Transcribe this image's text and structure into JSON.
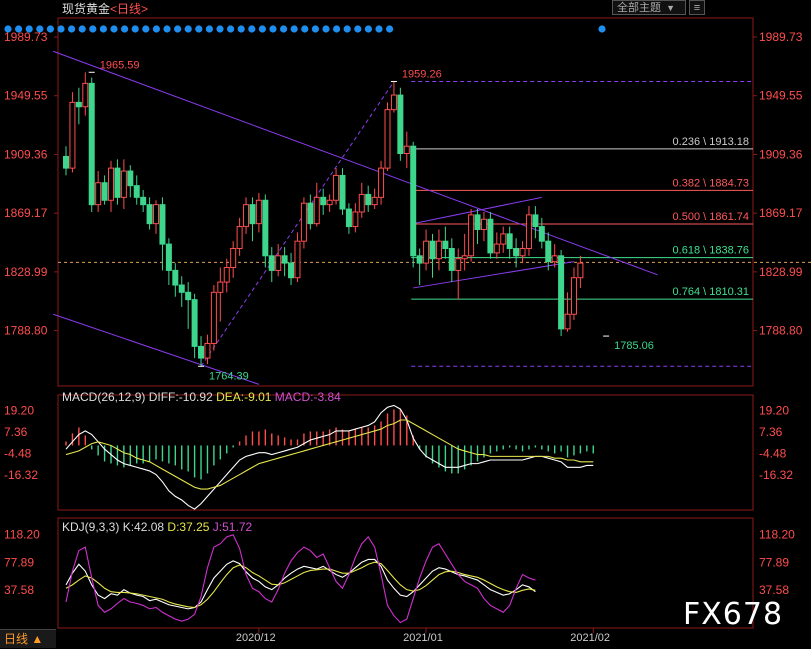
{
  "header": {
    "title": "现货黄金",
    "period_link": "<日线>",
    "theme_button": "全部主题",
    "theme_arrow": "▼"
  },
  "macd_header": {
    "title": "MACD(26,12,9)",
    "diff": "DIFF:-10.92",
    "dea": "DEA:-9.01",
    "macd": "MACD:-3.84"
  },
  "kdj_header": {
    "title": "KDJ(9,3,3)",
    "k": "K:42.08",
    "d": "D:37.25",
    "j": "J:51.72"
  },
  "footer": {
    "period_button": "日线 ▲",
    "watermark": "FX678"
  },
  "colors": {
    "up": "#ff4d4d",
    "down": "#3dd68c",
    "trend": "#8a3cf0",
    "dea": "#e6e64d",
    "macd_label": "#d050d0",
    "label_text": "#ff5050",
    "fib_red": "#ff5a5a",
    "fib_green": "#40e090",
    "fib_grey": "#cccccc"
  },
  "chart_data": {
    "type": "candlestick",
    "instrument": "现货黄金",
    "period": "日线",
    "price_axis_ticks": [
      1989.73,
      1949.55,
      1909.36,
      1869.17,
      1828.99,
      1788.8
    ],
    "price_range": [
      1755,
      2000
    ],
    "x_tick_labels": [
      {
        "label": "2020/12",
        "index": 30
      },
      {
        "label": "2021/01",
        "index": 56
      },
      {
        "label": "2021/02",
        "index": 82
      }
    ],
    "annotations": [
      {
        "text": "1965.59",
        "index": 4,
        "price": 1965.59,
        "color": "up"
      },
      {
        "text": "1764.39",
        "index": 21,
        "price": 1764.39,
        "color": "down"
      },
      {
        "text": "1959.26",
        "index": 51,
        "price": 1959.26,
        "color": "up"
      },
      {
        "text": "1785.06",
        "index": 84,
        "price": 1785.06,
        "color": "down"
      }
    ],
    "fibonacci": [
      {
        "ratio": "0.236",
        "price": 1913.18,
        "label": "0.236 \\ 1913.18",
        "color": "fib_grey"
      },
      {
        "ratio": "0.382",
        "price": 1884.73,
        "label": "0.382 \\ 1884.73",
        "color": "fib_red"
      },
      {
        "ratio": "0.500",
        "price": 1861.74,
        "label": "0.500 \\ 1861.74",
        "color": "fib_red"
      },
      {
        "ratio": "0.618",
        "price": 1838.76,
        "label": "0.618 \\ 1838.76",
        "color": "fib_green"
      },
      {
        "ratio": "0.764",
        "price": 1810.31,
        "label": "0.764 \\ 1810.31",
        "color": "fib_green"
      }
    ],
    "current_price": 1835.5,
    "candles": [
      [
        1908,
        1900,
        1915,
        1895
      ],
      [
        1900,
        1945,
        1952,
        1897
      ],
      [
        1945,
        1942,
        1955,
        1930
      ],
      [
        1942,
        1958,
        1965.59,
        1936
      ],
      [
        1958,
        1875,
        1962,
        1870
      ],
      [
        1875,
        1890,
        1898,
        1870
      ],
      [
        1890,
        1878,
        1895,
        1875
      ],
      [
        1878,
        1900,
        1905,
        1870
      ],
      [
        1900,
        1880,
        1906,
        1875
      ],
      [
        1880,
        1898,
        1906,
        1872
      ],
      [
        1898,
        1888,
        1902,
        1880
      ],
      [
        1888,
        1880,
        1895,
        1875
      ],
      [
        1880,
        1875,
        1885,
        1870
      ],
      [
        1875,
        1862,
        1880,
        1858
      ],
      [
        1862,
        1875,
        1878,
        1855
      ],
      [
        1875,
        1848,
        1880,
        1830
      ],
      [
        1848,
        1830,
        1852,
        1820
      ],
      [
        1830,
        1820,
        1835,
        1812
      ],
      [
        1820,
        1815,
        1826,
        1805
      ],
      [
        1815,
        1810,
        1822,
        1790
      ],
      [
        1810,
        1778,
        1814,
        1770
      ],
      [
        1778,
        1770,
        1785,
        1764.39
      ],
      [
        1770,
        1780,
        1786,
        1766
      ],
      [
        1780,
        1815,
        1820,
        1775
      ],
      [
        1815,
        1822,
        1832,
        1795
      ],
      [
        1822,
        1832,
        1838,
        1815
      ],
      [
        1832,
        1845,
        1850,
        1825
      ],
      [
        1845,
        1860,
        1866,
        1840
      ],
      [
        1860,
        1875,
        1880,
        1855
      ],
      [
        1875,
        1862,
        1880,
        1850
      ],
      [
        1862,
        1878,
        1883,
        1856
      ],
      [
        1878,
        1840,
        1882,
        1832
      ],
      [
        1840,
        1830,
        1846,
        1822
      ],
      [
        1830,
        1840,
        1848,
        1826
      ],
      [
        1840,
        1835,
        1846,
        1826
      ],
      [
        1835,
        1825,
        1842,
        1820
      ],
      [
        1825,
        1850,
        1856,
        1822
      ],
      [
        1850,
        1876,
        1880,
        1845
      ],
      [
        1876,
        1862,
        1882,
        1858
      ],
      [
        1862,
        1880,
        1890,
        1860
      ],
      [
        1880,
        1875,
        1886,
        1868
      ],
      [
        1875,
        1878,
        1882,
        1870
      ],
      [
        1878,
        1895,
        1900,
        1875
      ],
      [
        1895,
        1872,
        1900,
        1868
      ],
      [
        1872,
        1860,
        1876,
        1855
      ],
      [
        1860,
        1870,
        1876,
        1856
      ],
      [
        1870,
        1882,
        1890,
        1866
      ],
      [
        1882,
        1875,
        1888,
        1870
      ],
      [
        1875,
        1880,
        1886,
        1872
      ],
      [
        1880,
        1900,
        1905,
        1875
      ],
      [
        1900,
        1940,
        1945,
        1898
      ],
      [
        1940,
        1950,
        1959.26,
        1938
      ],
      [
        1950,
        1910,
        1955,
        1905
      ],
      [
        1910,
        1915,
        1925,
        1900
      ],
      [
        1915,
        1840,
        1918,
        1832
      ],
      [
        1840,
        1835,
        1845,
        1820
      ],
      [
        1835,
        1850,
        1858,
        1830
      ],
      [
        1850,
        1838,
        1855,
        1825
      ],
      [
        1838,
        1850,
        1858,
        1830
      ],
      [
        1850,
        1845,
        1860,
        1838
      ],
      [
        1845,
        1830,
        1852,
        1822
      ],
      [
        1830,
        1838,
        1845,
        1810
      ],
      [
        1838,
        1840,
        1855,
        1830
      ],
      [
        1840,
        1868,
        1872,
        1836
      ],
      [
        1868,
        1858,
        1872,
        1848
      ],
      [
        1858,
        1865,
        1870,
        1850
      ],
      [
        1865,
        1842,
        1870,
        1838
      ],
      [
        1842,
        1848,
        1856,
        1838
      ],
      [
        1848,
        1855,
        1860,
        1842
      ],
      [
        1855,
        1845,
        1860,
        1838
      ],
      [
        1845,
        1840,
        1852,
        1832
      ],
      [
        1840,
        1845,
        1850,
        1835
      ],
      [
        1845,
        1868,
        1874,
        1840
      ],
      [
        1868,
        1860,
        1874,
        1852
      ],
      [
        1860,
        1850,
        1866,
        1845
      ],
      [
        1850,
        1836,
        1856,
        1830
      ],
      [
        1836,
        1840,
        1848,
        1832
      ],
      [
        1840,
        1790,
        1844,
        1785.06
      ],
      [
        1790,
        1800,
        1815,
        1788
      ],
      [
        1800,
        1825,
        1832,
        1796
      ],
      [
        1825,
        1835,
        1840,
        1818
      ]
    ],
    "trendlines_price": [
      {
        "from": [
          -2,
          1980
        ],
        "to": [
          92,
          1827
        ]
      },
      {
        "from": [
          -2,
          1800
        ],
        "to": [
          30,
          1752
        ]
      },
      {
        "from": [
          21,
          1764.39
        ],
        "to": [
          51,
          1959.26
        ],
        "dashed": true
      },
      {
        "from": [
          54,
          1818
        ],
        "to": [
          79,
          1836
        ]
      },
      {
        "from": [
          54,
          1862
        ],
        "to": [
          74,
          1880
        ]
      }
    ],
    "dashed_levels": [
      1959.26,
      1764.39
    ],
    "macd": {
      "ticks": [
        19.2,
        7.36,
        -4.48,
        -16.32
      ],
      "diff_last": -10.92,
      "dea_last": -9.01,
      "macd_last": -3.84,
      "hist": [
        2,
        6,
        9,
        5,
        -2,
        -5,
        -8,
        -9,
        -10,
        -11,
        -10,
        -9,
        -9,
        -8,
        -7,
        -8,
        -9,
        -10,
        -12,
        -13,
        -16,
        -17,
        -14,
        -10,
        -7,
        -4,
        -1,
        2,
        5,
        7,
        7,
        8,
        6,
        5,
        4,
        3,
        3,
        6,
        7,
        7,
        7,
        8,
        9,
        8,
        7,
        8,
        9,
        9,
        10,
        12,
        16,
        18,
        18,
        15,
        5,
        -2,
        -6,
        -9,
        -11,
        -13,
        -14,
        -14,
        -12,
        -10,
        -8,
        -6,
        -4,
        -3,
        -2,
        -1,
        -2,
        -3,
        -2,
        -1,
        -2,
        -3,
        -4,
        -3,
        -6,
        -5,
        -4,
        -3,
        -4
      ],
      "diff": [
        -2,
        2,
        6,
        8,
        6,
        2,
        -2,
        -5,
        -8,
        -10,
        -11,
        -12,
        -13,
        -14,
        -16,
        -20,
        -25,
        -28,
        -30,
        -33,
        -35,
        -32,
        -28,
        -24,
        -20,
        -16,
        -12,
        -8,
        -6,
        -5,
        -4,
        -4,
        -5,
        -4,
        -3,
        -2,
        -1,
        1,
        3,
        4,
        5,
        6,
        8,
        8,
        8,
        9,
        10,
        11,
        13,
        18,
        21,
        22,
        20,
        14,
        4,
        -2,
        -6,
        -8,
        -10,
        -12,
        -12,
        -12,
        -11,
        -10,
        -10,
        -9,
        -8,
        -8,
        -8,
        -8,
        -8,
        -8,
        -7,
        -6,
        -6,
        -7,
        -8,
        -9,
        -12,
        -12,
        -12,
        -11,
        -11
      ],
      "dea": [
        -5,
        -4,
        -3,
        -1,
        1,
        2,
        1,
        0,
        -2,
        -4,
        -5,
        -7,
        -8,
        -9,
        -11,
        -13,
        -15,
        -17,
        -19,
        -21,
        -23,
        -24,
        -24,
        -23,
        -22,
        -20,
        -18,
        -16,
        -14,
        -12,
        -10,
        -9,
        -8,
        -7,
        -6,
        -5,
        -4,
        -3,
        -2,
        -1,
        0,
        1,
        2,
        3,
        4,
        5,
        6,
        7,
        8,
        9,
        11,
        12,
        14,
        14,
        12,
        10,
        8,
        6,
        4,
        2,
        0,
        -2,
        -3,
        -4,
        -5,
        -5,
        -6,
        -6,
        -6,
        -6,
        -6,
        -6,
        -6,
        -6,
        -6,
        -6,
        -7,
        -7,
        -8,
        -8,
        -9,
        -9,
        -9
      ]
    },
    "kdj": {
      "ticks": [
        118.2,
        77.89,
        37.58
      ],
      "k_last": 42.08,
      "d_last": 37.25,
      "j_last": 51.72,
      "k": [
        45,
        62,
        75,
        65,
        45,
        30,
        25,
        32,
        30,
        38,
        33,
        30,
        28,
        22,
        24,
        20,
        16,
        14,
        12,
        10,
        12,
        20,
        38,
        55,
        65,
        75,
        80,
        76,
        64,
        55,
        50,
        42,
        38,
        45,
        55,
        62,
        68,
        72,
        70,
        68,
        72,
        66,
        60,
        56,
        62,
        70,
        78,
        82,
        82,
        72,
        52,
        40,
        30,
        28,
        35,
        45,
        55,
        65,
        70,
        68,
        64,
        60,
        58,
        55,
        52,
        45,
        38,
        34,
        30,
        32,
        38,
        45,
        42,
        35
      ],
      "d": [
        40,
        45,
        52,
        58,
        55,
        48,
        40,
        35,
        34,
        34,
        33,
        32,
        30,
        28,
        26,
        24,
        20,
        17,
        15,
        13,
        12,
        16,
        24,
        35,
        48,
        60,
        70,
        74,
        70,
        63,
        58,
        52,
        46,
        45,
        48,
        53,
        58,
        63,
        66,
        67,
        68,
        68,
        65,
        62,
        62,
        66,
        70,
        75,
        78,
        76,
        66,
        55,
        45,
        38,
        36,
        38,
        44,
        52,
        60,
        64,
        65,
        63,
        60,
        58,
        56,
        52,
        47,
        42,
        38,
        35,
        34,
        37,
        39,
        37
      ],
      "j": [
        20,
        65,
        95,
        100,
        55,
        15,
        5,
        10,
        18,
        25,
        20,
        18,
        15,
        10,
        12,
        5,
        0,
        -5,
        -8,
        -5,
        2,
        28,
        70,
        100,
        105,
        115,
        118,
        98,
        60,
        40,
        35,
        25,
        20,
        38,
        62,
        80,
        92,
        100,
        95,
        85,
        90,
        70,
        50,
        40,
        60,
        85,
        105,
        115,
        100,
        60,
        15,
        0,
        -10,
        -5,
        25,
        55,
        80,
        100,
        105,
        90,
        75,
        60,
        50,
        45,
        40,
        25,
        15,
        10,
        5,
        15,
        40,
        60,
        55,
        52
      ]
    }
  }
}
